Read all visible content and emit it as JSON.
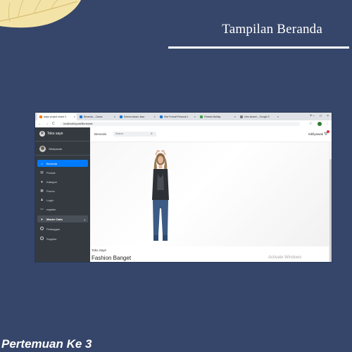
{
  "slide": {
    "title": "Tampilan Beranda",
    "footer": "Pertemuan Ke 3"
  },
  "browser": {
    "tabs": [
      {
        "label": "lanjut project closet X",
        "color": "#f57c00",
        "active": true
      },
      {
        "label": "Beranda – Canva",
        "color": "#1976d2"
      },
      {
        "label": "Demos steam Jasa",
        "color": "#1976d2"
      },
      {
        "label": "Kita Format Personal L",
        "color": "#1976d2"
      },
      {
        "label": "Fitnesia Bahlap",
        "color": "#43a047"
      },
      {
        "label": "Intro laravel – Google S",
        "color": "#7b7b7b"
      }
    ],
    "new_tab": "+",
    "window_controls": [
      "–",
      "□",
      "×"
    ],
    "nav": {
      "back": "←",
      "forward": "→",
      "reload": "C"
    },
    "url": "localhost/toyota/Beranda#"
  },
  "sidebar": {
    "brand_initial": "R",
    "brand": "Toko saye",
    "user": "Sikfiyawati",
    "items": [
      {
        "label": "Beranda",
        "icon": "⌂",
        "icon_name": "home-icon",
        "active": true
      },
      {
        "label": "Produk",
        "icon": "▤",
        "icon_name": "product-icon"
      },
      {
        "label": "Kategori",
        "icon": "▼",
        "icon_name": "shirt-icon"
      },
      {
        "label": "Promo",
        "icon": "▦",
        "icon_name": "promo-icon"
      },
      {
        "label": "Login",
        "icon": "♟",
        "icon_name": "user-icon"
      },
      {
        "label": "register",
        "icon": "▭",
        "icon_name": "register-icon"
      },
      {
        "label": "Master Data",
        "icon": "●",
        "icon_name": "database-icon",
        "section": true
      },
      {
        "label": "Pelanggan",
        "icon": "○",
        "icon_name": "circle-icon"
      },
      {
        "label": "Supplier",
        "icon": "○",
        "icon_name": "circle-icon"
      }
    ]
  },
  "topbar": {
    "home": "Beranda",
    "search_placeholder": "Search",
    "search_icon": "⌕",
    "user": "Sikfiyawati",
    "cart_icon": "🛒"
  },
  "content": {
    "caption_small": "Toko Saye",
    "caption_big": "Fashion Banget",
    "watermark": "Activate Windows"
  },
  "colors": {
    "slide_bg": "#36466a",
    "sidebar_bg": "#343a40",
    "active_menu": "#007bff",
    "badge": "#dc3545"
  }
}
